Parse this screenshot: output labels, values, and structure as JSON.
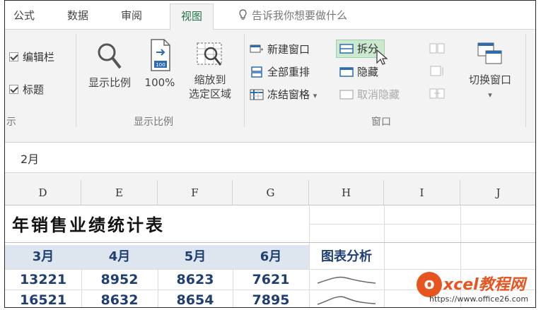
{
  "tabs": [
    {
      "label": "公式",
      "active": false
    },
    {
      "label": "数据",
      "active": false
    },
    {
      "label": "审阅",
      "active": false
    },
    {
      "label": "视图",
      "active": true
    }
  ],
  "tell_me": "告诉我你想要做什么",
  "ribbon": {
    "show_group": {
      "formula_bar": "编辑栏",
      "headings": "标题",
      "label_partial": "示"
    },
    "zoom_group": {
      "zoom_btn": "显示比例",
      "zoom100_btn": "100%",
      "zoom100_icon_text": "100",
      "zoom_sel_line1": "缩放到",
      "zoom_sel_line2": "选定区域",
      "label": "显示比例"
    },
    "window_group": {
      "new_window": "新建窗口",
      "arrange_all": "全部重排",
      "freeze_panes": "冻结窗格",
      "freeze_caret": "▾",
      "split": "拆分",
      "hide": "隐藏",
      "unhide": "取消隐藏",
      "switch_windows": "切换窗口",
      "switch_caret": "▾",
      "label": "窗口"
    }
  },
  "formula_bar": {
    "value": "2月"
  },
  "grid": {
    "columns": [
      "D",
      "E",
      "F",
      "G",
      "H",
      "I",
      "J"
    ],
    "title_partial": "年销售业绩统计表",
    "header_row": [
      "3月",
      "4月",
      "5月",
      "6月",
      "图表分析"
    ],
    "rows": [
      [
        "13221",
        "8952",
        "8623",
        "7621"
      ],
      [
        "16521",
        "8632",
        "8654",
        "7895"
      ]
    ]
  },
  "watermark": {
    "brand": "xcel教程网",
    "logo_letter": "o",
    "url": "https://www.office26.com"
  },
  "colors": {
    "active_tab": "#217346",
    "header_band": "#dde5ef",
    "header_text": "#1f3f73",
    "split_hover": "#cce8cf",
    "watermark": "#e8541f"
  }
}
